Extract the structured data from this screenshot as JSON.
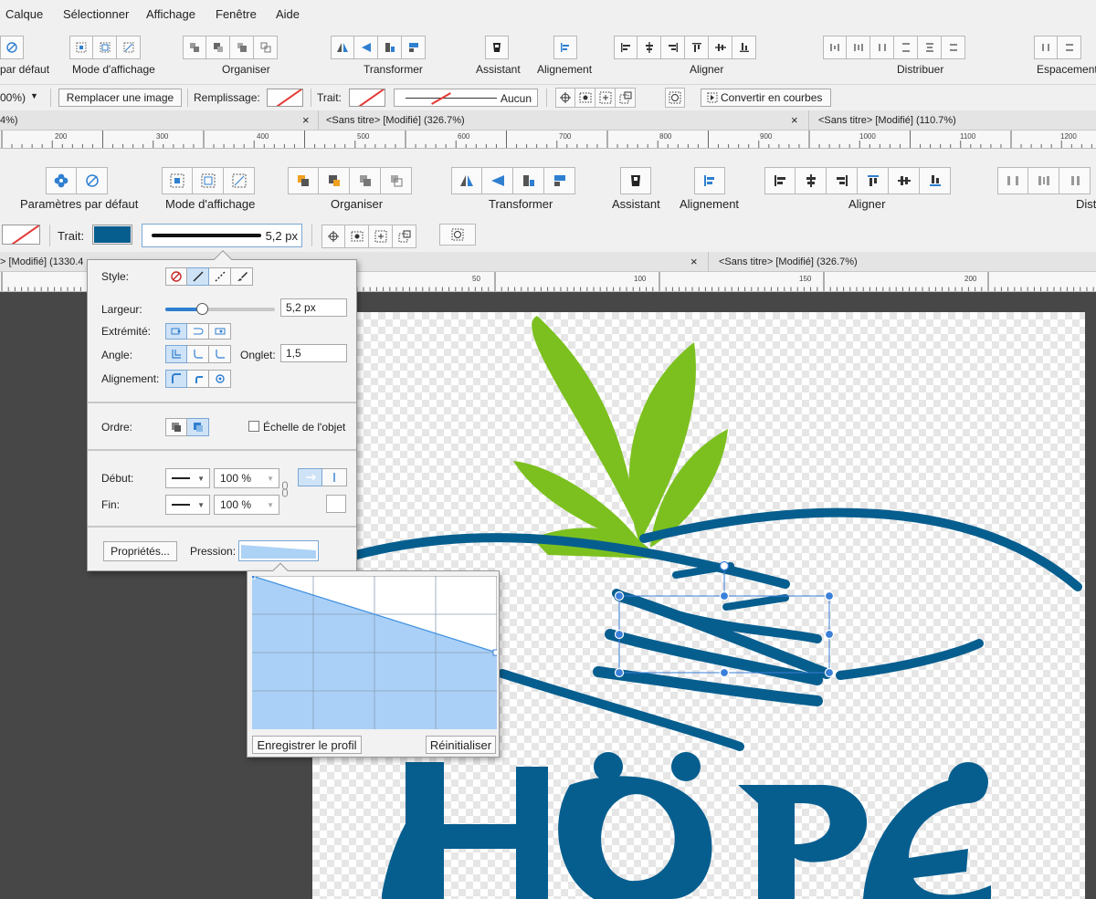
{
  "menu": [
    "Calque",
    "Sélectionner",
    "Affichage",
    "Fenêtre",
    "Aide"
  ],
  "toolbar_top": {
    "groups": [
      "par défaut",
      "Mode d'affichage",
      "Organiser",
      "Transformer",
      "Assistant",
      "Alignement",
      "Aligner",
      "Distribuer",
      "Espacement"
    ]
  },
  "context_top": {
    "zoom": "00%)",
    "replace_image": "Remplacer une image",
    "fill_label": "Remplissage:",
    "stroke_label": "Trait:",
    "stroke_value": "Aucun",
    "convert_curves": "Convertir en courbes"
  },
  "tabs_top": [
    {
      "label": "4%)",
      "close": "×"
    },
    {
      "label": "<Sans titre> [Modifié] (326.7%)",
      "close": "×"
    },
    {
      "label": "<Sans titre> [Modifié] (110.7%)"
    }
  ],
  "ruler_top": [
    "200",
    "300",
    "400",
    "500",
    "600",
    "700",
    "800",
    "900",
    "1000",
    "1100",
    "1200"
  ],
  "toolbar_main": {
    "groups": [
      "Paramètres par défaut",
      "Mode d'affichage",
      "Organiser",
      "Transformer",
      "Assistant",
      "Alignement",
      "Aligner",
      "Dist"
    ]
  },
  "context_main": {
    "stroke_label": "Trait:",
    "stroke_color": "#065e8f",
    "width_value": "5,2 px"
  },
  "tabs_main": [
    {
      "label": "> [Modifié] (1330.4"
    },
    {
      "label": "<Sans titre> [Modifié] (326.7%)",
      "close": "×"
    }
  ],
  "ruler_main": [
    "50",
    "100",
    "150",
    "200"
  ],
  "stroke_panel": {
    "style_label": "Style:",
    "width_label": "Largeur:",
    "width_value": "5,2 px",
    "width_fraction": 0.33,
    "cap_label": "Extrémité:",
    "join_label": "Angle:",
    "miter_label": "Onglet:",
    "miter_value": "1,5",
    "align_label": "Alignement:",
    "order_label": "Ordre:",
    "scale_label": "Échelle de l'objet",
    "start_label": "Début:",
    "start_pct": "100 %",
    "end_label": "Fin:",
    "end_pct": "100 %",
    "properties_button": "Propriétés...",
    "pressure_label": "Pression:"
  },
  "pressure_popup": {
    "save_button": "Enregistrer le profil",
    "reset_button": "Réinitialiser",
    "curve_start": 1.0,
    "curve_end": 0.5
  },
  "colors": {
    "brand_blue": "#065e8f",
    "leaf_green": "#7cc01f",
    "accent_blue": "#2f7fd0"
  }
}
